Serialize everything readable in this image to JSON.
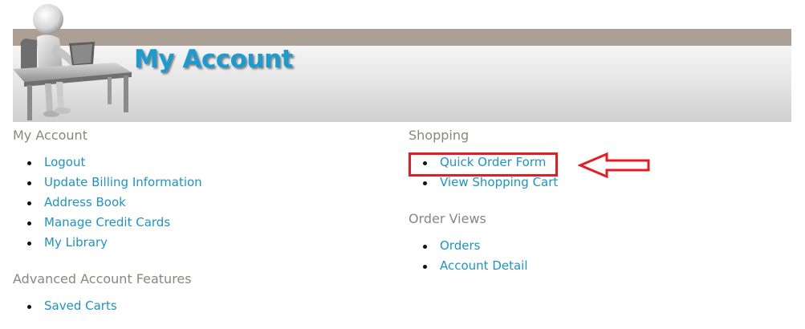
{
  "banner": {
    "title": "My Account"
  },
  "my_account": {
    "heading": "My Account",
    "items": [
      {
        "label": "Logout"
      },
      {
        "label": "Update Billing Information"
      },
      {
        "label": "Address Book"
      },
      {
        "label": "Manage Credit Cards"
      },
      {
        "label": "My Library"
      }
    ]
  },
  "advanced": {
    "heading": "Advanced Account Features",
    "items": [
      {
        "label": "Saved Carts"
      }
    ]
  },
  "shopping": {
    "heading": "Shopping",
    "items": [
      {
        "label": "Quick Order Form"
      },
      {
        "label": "View Shopping Cart"
      }
    ]
  },
  "order_views": {
    "heading": "Order Views",
    "items": [
      {
        "label": "Orders"
      },
      {
        "label": "Account Detail"
      }
    ]
  },
  "colors": {
    "link": "#1e93c6",
    "heading": "#8b8682",
    "title": "#1b9bd0",
    "banner_strip": "#ab9f96",
    "annotation": "#e21d24"
  },
  "icons": {
    "banner_figure": "person-at-laptop-icon",
    "annotation_arrow": "left-arrow-icon"
  }
}
